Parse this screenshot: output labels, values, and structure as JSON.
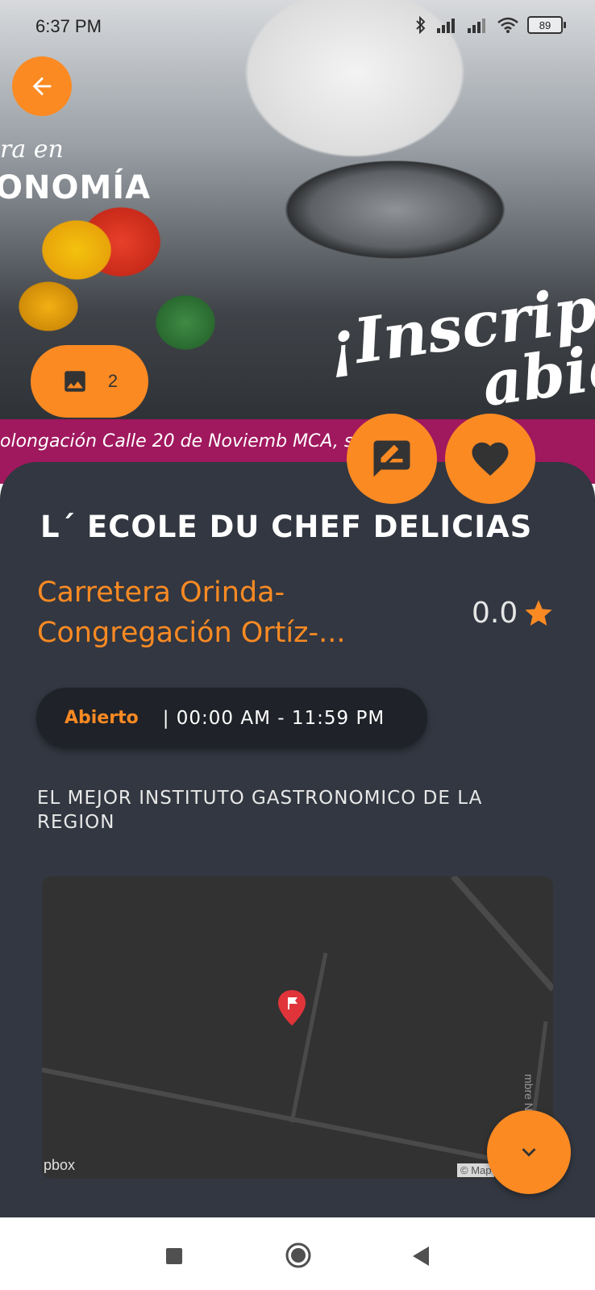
{
  "status_bar": {
    "time": "6:37 PM",
    "battery": "89"
  },
  "hero": {
    "image_semantic": "chef cooking with pan and vegetables",
    "text_left_small": "ra en",
    "text_left": "ONOMÍA",
    "script_line1": "¡Inscripcio",
    "script_line2": "abie",
    "banner_text": "olongación Calle 20 de Noviemb          MCA, s"
  },
  "gallery": {
    "count": "2"
  },
  "place": {
    "name": "L´ ECOLE DU CHEF DELICIAS",
    "address_line1": "Carretera Orinda-",
    "address_line2": "Congregación Ortíz-...",
    "rating": "0.0",
    "open_status": "Abierto",
    "hours": "| 00:00 AM - 11:59 PM",
    "description": "EL MEJOR INSTITUTO GASTRONOMICO DE LA REGION"
  },
  "map": {
    "attribution": "pbox",
    "copyright": "© Map",
    "street_label": "mbre N"
  },
  "colors": {
    "accent": "#fb8a23",
    "card_bg": "#323741",
    "hours_bg": "#1f2228",
    "map_bg": "#323232",
    "pin": "#e0343a"
  },
  "icons": {
    "back": "arrow-left-icon",
    "gallery": "image-icon",
    "review": "rate-review-icon",
    "favorite": "heart-icon",
    "rating": "star-icon",
    "expand": "chevron-down-icon",
    "map_pin": "map-pin-icon"
  }
}
